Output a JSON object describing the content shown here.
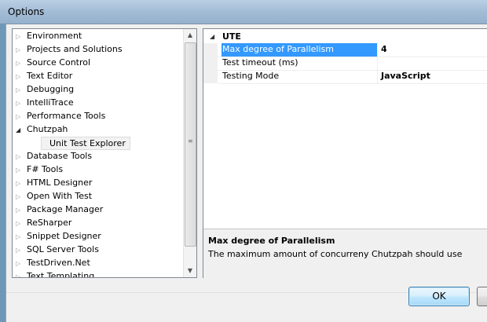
{
  "window": {
    "title": "Options"
  },
  "tree": {
    "items": [
      {
        "label": "Environment",
        "state": "collapsed"
      },
      {
        "label": "Projects and Solutions",
        "state": "collapsed"
      },
      {
        "label": "Source Control",
        "state": "collapsed"
      },
      {
        "label": "Text Editor",
        "state": "collapsed"
      },
      {
        "label": "Debugging",
        "state": "collapsed"
      },
      {
        "label": "IntelliTrace",
        "state": "collapsed"
      },
      {
        "label": "Performance Tools",
        "state": "collapsed"
      },
      {
        "label": "Chutzpah",
        "state": "expanded"
      },
      {
        "label": "Unit Test Explorer",
        "state": "selected-child"
      },
      {
        "label": "Database Tools",
        "state": "collapsed"
      },
      {
        "label": "F# Tools",
        "state": "collapsed"
      },
      {
        "label": "HTML Designer",
        "state": "collapsed"
      },
      {
        "label": "Open With Test",
        "state": "collapsed"
      },
      {
        "label": "Package Manager",
        "state": "collapsed"
      },
      {
        "label": "ReSharper",
        "state": "collapsed"
      },
      {
        "label": "Snippet Designer",
        "state": "collapsed"
      },
      {
        "label": "SQL Server Tools",
        "state": "collapsed"
      },
      {
        "label": "TestDriven.Net",
        "state": "collapsed"
      },
      {
        "label": "Text Templating",
        "state": "collapsed"
      }
    ]
  },
  "properties": {
    "category": "UTE",
    "rows": [
      {
        "name": "Max degree of Parallelism",
        "value": "4"
      },
      {
        "name": "Test timeout (ms)",
        "value": ""
      },
      {
        "name": "Testing Mode",
        "value": "JavaScript"
      }
    ],
    "description": {
      "title": "Max degree of Parallelism",
      "text": "The maximum amount of concurreny Chutzpah should use"
    }
  },
  "buttons": {
    "ok": "OK"
  },
  "colors": {
    "selection": "#3399ff",
    "title_bar": "#a3bcd6"
  }
}
